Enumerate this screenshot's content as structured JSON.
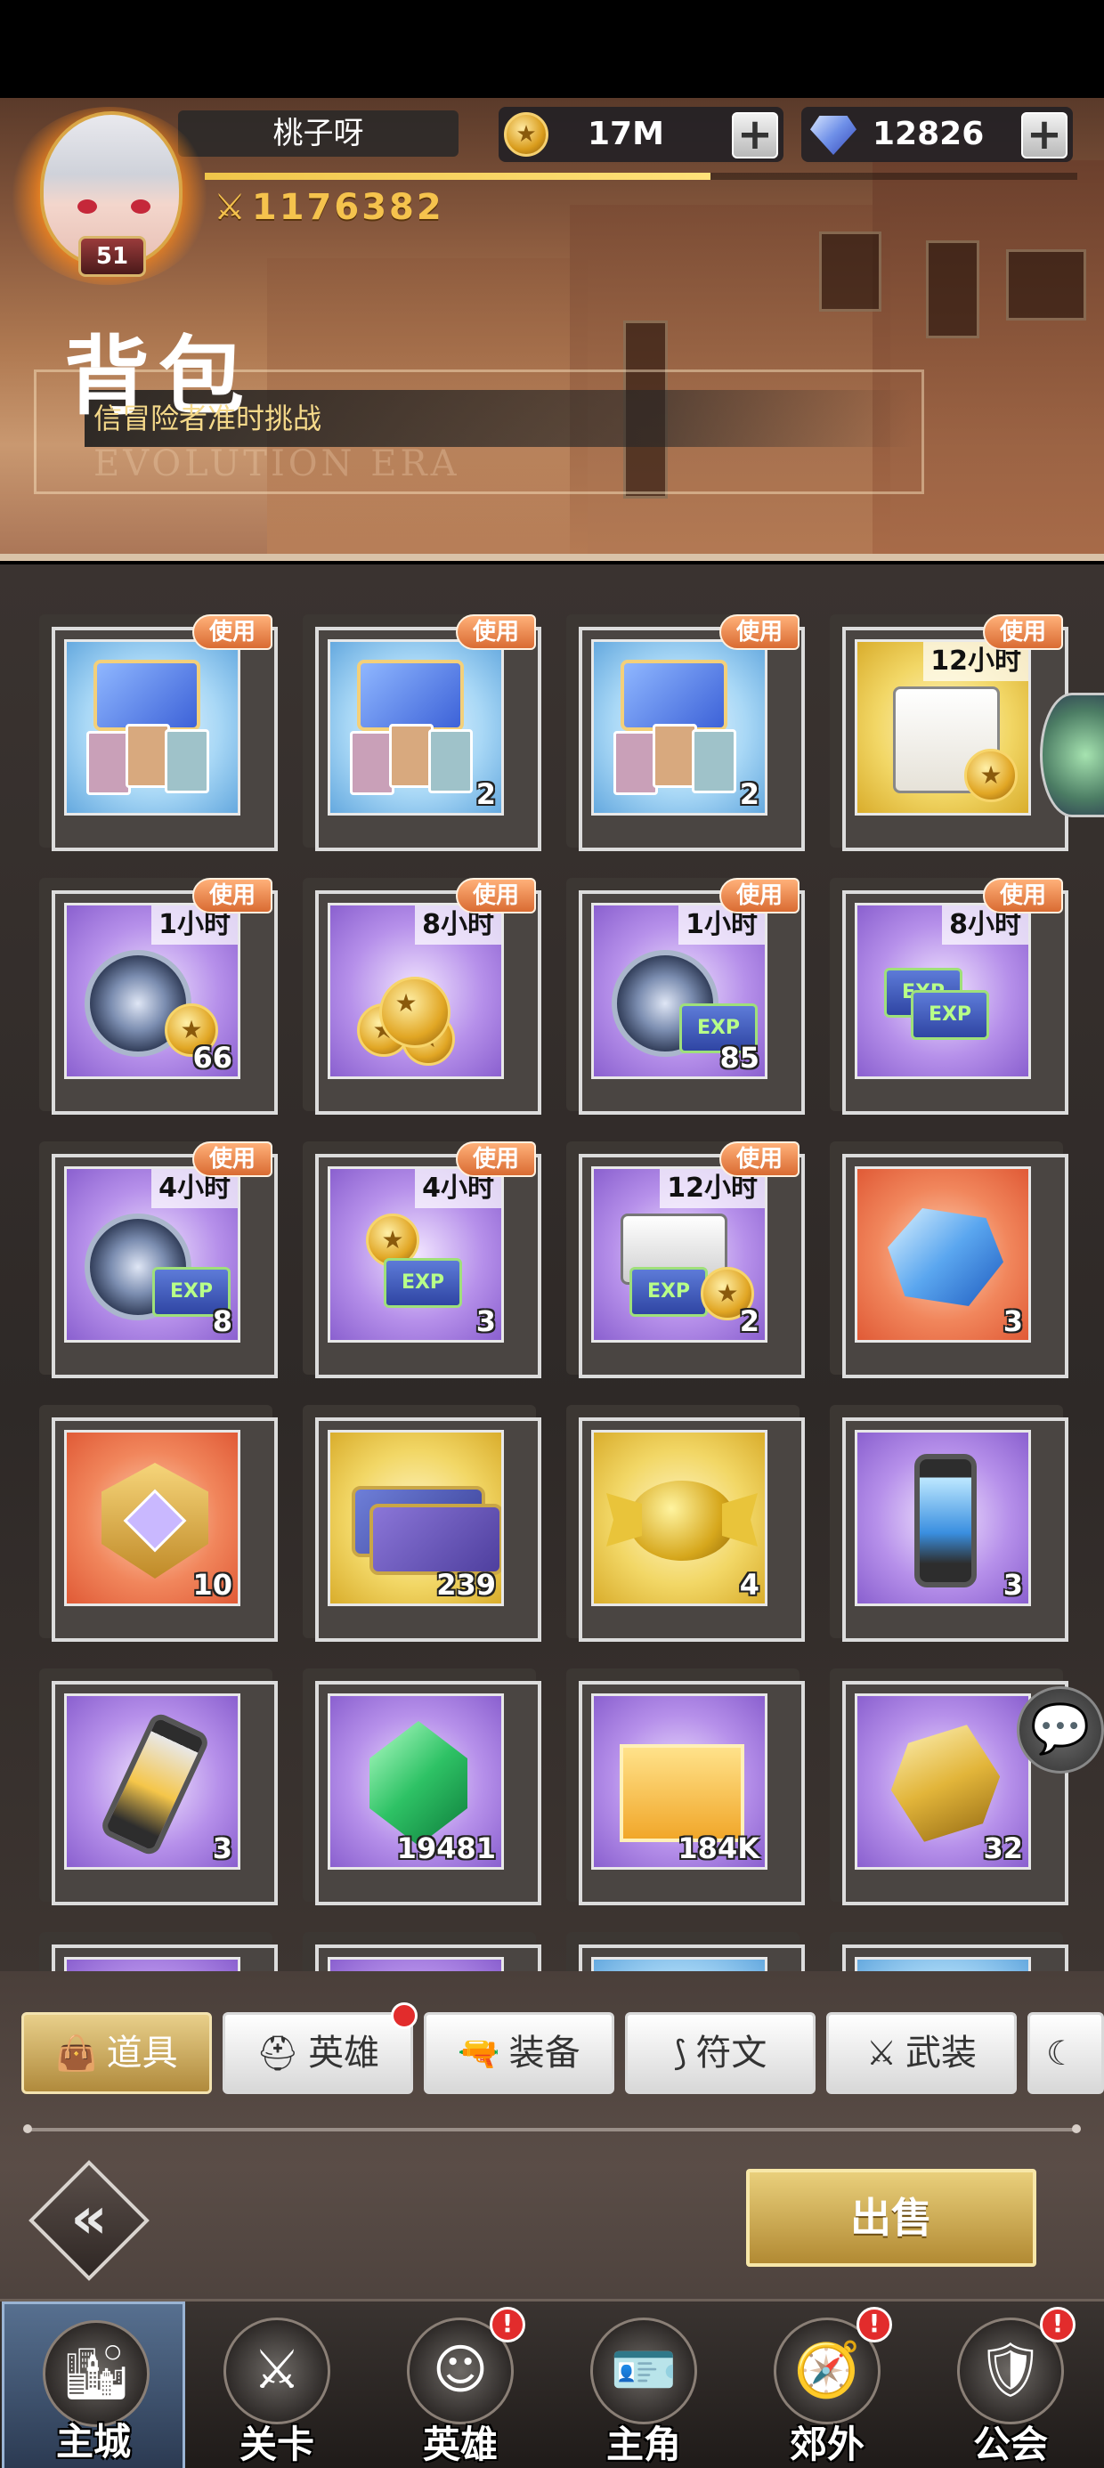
{
  "player": {
    "name": "桃子呀",
    "level": "51",
    "power": "1176382",
    "exp_progress": 0.58
  },
  "resources": {
    "gold": "17M",
    "gems": "12826"
  },
  "page": {
    "title": "背包",
    "subtitle": "信冒险者准时挑战",
    "subtitle_en": "EVOLUTION ERA"
  },
  "use_label": "使用",
  "items": [
    {
      "bg": "blue",
      "art": "gift-pack-cards",
      "use": true,
      "time": "",
      "count": ""
    },
    {
      "bg": "blue",
      "art": "gift-pack-cards",
      "use": true,
      "time": "",
      "count": "2"
    },
    {
      "bg": "blue",
      "art": "gift-pack-cards",
      "use": true,
      "time": "",
      "count": "2"
    },
    {
      "bg": "gold",
      "art": "gold-box",
      "use": true,
      "time": "12小时",
      "count": ""
    },
    {
      "bg": "purple",
      "art": "ring-coin",
      "use": true,
      "time": "1小时",
      "count": "66"
    },
    {
      "bg": "purple",
      "art": "coin-stack",
      "use": true,
      "time": "8小时",
      "count": ""
    },
    {
      "bg": "purple",
      "art": "ring-exp",
      "use": true,
      "time": "1小时",
      "count": "85"
    },
    {
      "bg": "purple",
      "art": "exp-stack",
      "use": true,
      "time": "8小时",
      "count": ""
    },
    {
      "bg": "purple",
      "art": "ring-exp",
      "use": true,
      "time": "4小时",
      "count": "8"
    },
    {
      "bg": "purple",
      "art": "coin-exp",
      "use": true,
      "time": "4小时",
      "count": "3"
    },
    {
      "bg": "purple",
      "art": "coin-exp-box",
      "use": true,
      "time": "12小时",
      "count": "2"
    },
    {
      "bg": "orange",
      "art": "crystal",
      "use": false,
      "time": "",
      "count": "3"
    },
    {
      "bg": "orange",
      "art": "medal",
      "use": false,
      "time": "",
      "count": "10"
    },
    {
      "bg": "gold",
      "art": "ticket",
      "use": false,
      "time": "",
      "count": "239"
    },
    {
      "bg": "gold",
      "art": "candy",
      "use": false,
      "time": "",
      "count": "4"
    },
    {
      "bg": "purple",
      "art": "tube-blue",
      "use": false,
      "time": "",
      "count": "3"
    },
    {
      "bg": "purple",
      "art": "tube-gold",
      "use": false,
      "time": "",
      "count": "3"
    },
    {
      "bg": "purple",
      "art": "green-gem",
      "use": false,
      "time": "",
      "count": "19481"
    },
    {
      "bg": "purple",
      "art": "gold-sand",
      "use": false,
      "time": "",
      "count": "184K"
    },
    {
      "bg": "purple",
      "art": "gold-crystal",
      "use": false,
      "time": "",
      "count": "32"
    },
    {
      "bg": "purple",
      "art": "",
      "use": false,
      "time": "",
      "count": ""
    },
    {
      "bg": "purple",
      "art": "",
      "use": false,
      "time": "",
      "count": ""
    },
    {
      "bg": "blue",
      "art": "",
      "use": false,
      "time": "",
      "count": ""
    },
    {
      "bg": "blue",
      "art": "",
      "use": false,
      "time": "",
      "count": ""
    }
  ],
  "tabs": [
    {
      "label": "道具",
      "icon": "bag-icon",
      "active": true,
      "dot": false
    },
    {
      "label": "英雄",
      "icon": "helmet-icon",
      "active": false,
      "dot": true
    },
    {
      "label": "装备",
      "icon": "gun-icon",
      "active": false,
      "dot": false
    },
    {
      "label": "符文",
      "icon": "rune-icon",
      "active": false,
      "dot": false
    },
    {
      "label": "武装",
      "icon": "weapon-icon",
      "active": false,
      "dot": false
    },
    {
      "label": "",
      "icon": "moon-icon",
      "active": false,
      "dot": false
    }
  ],
  "sell_label": "出售",
  "nav": [
    {
      "label": "主城",
      "icon": "city-icon",
      "active": true,
      "alert": false
    },
    {
      "label": "关卡",
      "icon": "swords-icon",
      "active": false,
      "alert": false
    },
    {
      "label": "英雄",
      "icon": "hero-icon",
      "active": false,
      "alert": true
    },
    {
      "label": "主角",
      "icon": "profile-icon",
      "active": false,
      "alert": false
    },
    {
      "label": "郊外",
      "icon": "map-icon",
      "active": false,
      "alert": true
    },
    {
      "label": "公会",
      "icon": "guild-icon",
      "active": false,
      "alert": true
    }
  ],
  "nav_alert_glyph": "!",
  "colors": {
    "accent_gold": "#f5c34d",
    "use_tag": "#d96b32",
    "alert_red": "#e22c2c"
  }
}
